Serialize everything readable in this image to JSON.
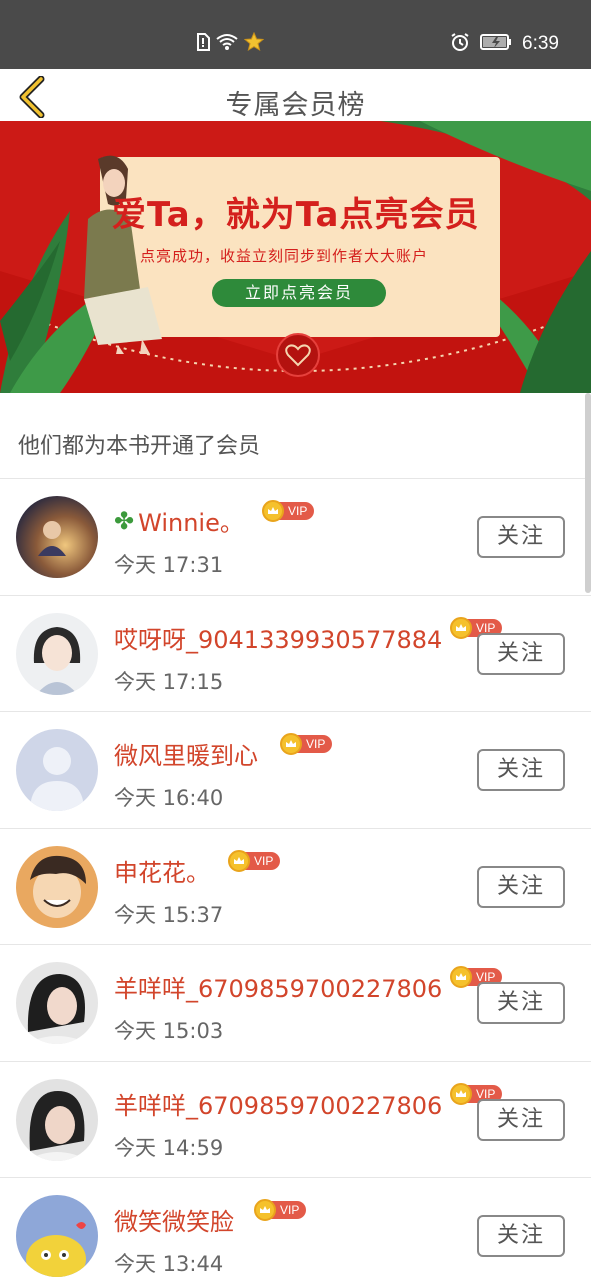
{
  "status_bar": {
    "time": "6:39",
    "icons": [
      "sim-alert-icon",
      "wifi-icon",
      "star-icon",
      "alarm-icon",
      "battery-charging-icon"
    ]
  },
  "header": {
    "title": "专属会员榜",
    "back_icon": "chevron-left-icon"
  },
  "banner": {
    "headline": "爱Ta，就为Ta点亮会员",
    "subtitle": "点亮成功，收益立刻同步到作者大大账户",
    "button_label": "立即点亮会员",
    "colors": {
      "background": "#cc1a16",
      "card": "#fbe3c0",
      "button": "#2e8a3a"
    }
  },
  "section_title": "他们都为本书开通了会员",
  "vip_label": "VIP",
  "follow_label": "关注",
  "members": [
    {
      "name": "Winnie。",
      "prefix_icon": "clover-icon",
      "time": "今天 17:31"
    },
    {
      "name": "哎呀呀_9041339930577884",
      "time": "今天 17:15"
    },
    {
      "name": "微风里暖到心",
      "time": "今天 16:40"
    },
    {
      "name": "申花花。",
      "time": "今天 15:37"
    },
    {
      "name": "羊咩咩_6709859700227806",
      "time": "今天 15:03"
    },
    {
      "name": "羊咩咩_6709859700227806",
      "time": "今天 14:59"
    },
    {
      "name": "微笑微笑脸",
      "time": "今天 13:44"
    }
  ],
  "accent_colors": {
    "name": "#d2452b",
    "vip_tag": "#e35a48",
    "crown": "#f5c12c"
  }
}
